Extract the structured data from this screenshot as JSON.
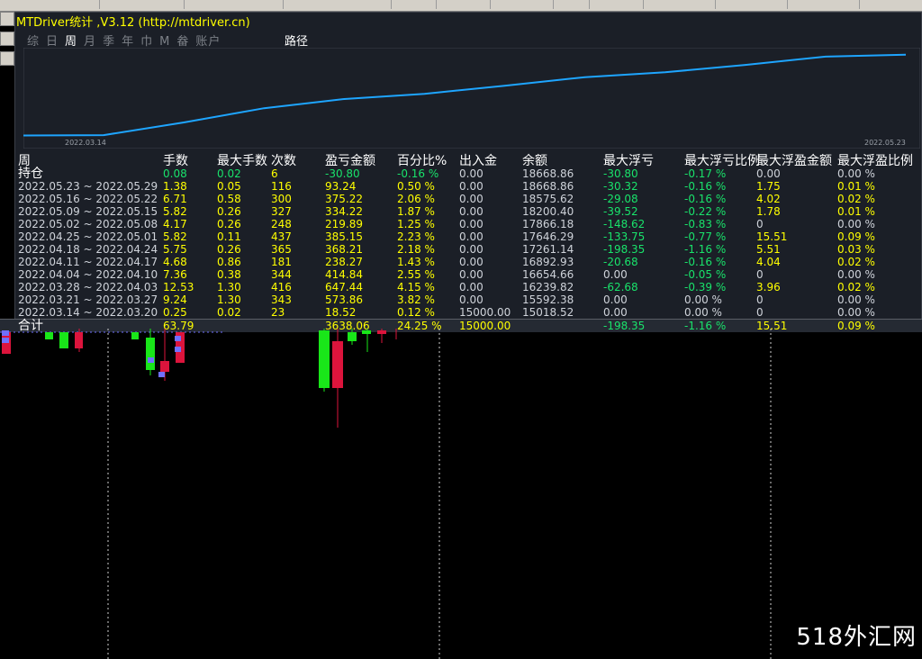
{
  "window": {
    "title": "MTDriver统计  ,V3.12 (http://mtdriver.cn)"
  },
  "tabs": {
    "items": [
      "综",
      "日",
      "周",
      "月",
      "季",
      "年",
      "巾",
      "M",
      "畚",
      "账户"
    ],
    "selected": "周",
    "path": "路径"
  },
  "equity_chart": {
    "x_start": "2022.03.14",
    "x_end": "2022.05.23",
    "line_color": "#1ea5ff",
    "chart_data": {
      "type": "line",
      "x": [
        "2022.03.14",
        "2022.03.21",
        "2022.03.28",
        "2022.04.04",
        "2022.04.11",
        "2022.04.18",
        "2022.04.25",
        "2022.05.02",
        "2022.05.09",
        "2022.05.16",
        "2022.05.23"
      ],
      "values": [
        15000,
        15018.52,
        15592.38,
        16239.82,
        16654.66,
        16892.93,
        17261.14,
        17646.29,
        17866.18,
        18200.4,
        18575.62,
        18668.86
      ]
    }
  },
  "table": {
    "headers": [
      "周",
      "手数",
      "最大手数",
      "次数",
      "盈亏金额",
      "百分比%",
      "出入金",
      "余额",
      "最大浮亏",
      "最大浮亏比例",
      "最大浮盈金额",
      "最大浮盈比例"
    ],
    "holding": {
      "label": "持仓",
      "lots": "0.08",
      "max_lots": "0.02",
      "count": "6",
      "pnl": "-30.80",
      "pct": "-0.16 %",
      "flow": "0.00",
      "balance": "18668.86",
      "max_loss": "-30.80",
      "max_loss_pct": "-0.17 %",
      "max_gain": "0.00",
      "max_gain_pct": "0.00 %"
    },
    "rows": [
      {
        "period": "2022.05.23 ~ 2022.05.29",
        "lots": "1.38",
        "max_lots": "0.05",
        "count": "116",
        "pnl": "93.24",
        "pct": "0.50 %",
        "flow": "0.00",
        "balance": "18668.86",
        "max_loss": "-30.32",
        "max_loss_pct": "-0.16 %",
        "max_gain": "1.75",
        "max_gain_pct": "0.01 %"
      },
      {
        "period": "2022.05.16 ~ 2022.05.22",
        "lots": "6.71",
        "max_lots": "0.58",
        "count": "300",
        "pnl": "375.22",
        "pct": "2.06 %",
        "flow": "0.00",
        "balance": "18575.62",
        "max_loss": "-29.08",
        "max_loss_pct": "-0.16 %",
        "max_gain": "4.02",
        "max_gain_pct": "0.02 %"
      },
      {
        "period": "2022.05.09 ~ 2022.05.15",
        "lots": "5.82",
        "max_lots": "0.26",
        "count": "327",
        "pnl": "334.22",
        "pct": "1.87 %",
        "flow": "0.00",
        "balance": "18200.40",
        "max_loss": "-39.52",
        "max_loss_pct": "-0.22 %",
        "max_gain": "1.78",
        "max_gain_pct": "0.01 %"
      },
      {
        "period": "2022.05.02 ~ 2022.05.08",
        "lots": "4.17",
        "max_lots": "0.26",
        "count": "248",
        "pnl": "219.89",
        "pct": "1.25 %",
        "flow": "0.00",
        "balance": "17866.18",
        "max_loss": "-148.62",
        "max_loss_pct": "-0.83 %",
        "max_gain": "0",
        "max_gain_pct": "0.00 %"
      },
      {
        "period": "2022.04.25 ~ 2022.05.01",
        "lots": "5.82",
        "max_lots": "0.11",
        "count": "437",
        "pnl": "385.15",
        "pct": "2.23 %",
        "flow": "0.00",
        "balance": "17646.29",
        "max_loss": "-133.75",
        "max_loss_pct": "-0.77 %",
        "max_gain": "15.51",
        "max_gain_pct": "0.09 %"
      },
      {
        "period": "2022.04.18 ~ 2022.04.24",
        "lots": "5.75",
        "max_lots": "0.26",
        "count": "365",
        "pnl": "368.21",
        "pct": "2.18 %",
        "flow": "0.00",
        "balance": "17261.14",
        "max_loss": "-198.35",
        "max_loss_pct": "-1.16 %",
        "max_gain": "5.51",
        "max_gain_pct": "0.03 %"
      },
      {
        "period": "2022.04.11 ~ 2022.04.17",
        "lots": "4.68",
        "max_lots": "0.86",
        "count": "181",
        "pnl": "238.27",
        "pct": "1.43 %",
        "flow": "0.00",
        "balance": "16892.93",
        "max_loss": "-20.68",
        "max_loss_pct": "-0.16 %",
        "max_gain": "4.04",
        "max_gain_pct": "0.02 %"
      },
      {
        "period": "2022.04.04 ~ 2022.04.10",
        "lots": "7.36",
        "max_lots": "0.38",
        "count": "344",
        "pnl": "414.84",
        "pct": "2.55 %",
        "flow": "0.00",
        "balance": "16654.66",
        "max_loss": "0.00",
        "max_loss_pct": "-0.05 %",
        "max_gain": "0",
        "max_gain_pct": "0.00 %"
      },
      {
        "period": "2022.03.28 ~ 2022.04.03",
        "lots": "12.53",
        "max_lots": "1.30",
        "count": "416",
        "pnl": "647.44",
        "pct": "4.15 %",
        "flow": "0.00",
        "balance": "16239.82",
        "max_loss": "-62.68",
        "max_loss_pct": "-0.39 %",
        "max_gain": "3.96",
        "max_gain_pct": "0.02 %"
      },
      {
        "period": "2022.03.21 ~ 2022.03.27",
        "lots": "9.24",
        "max_lots": "1.30",
        "count": "343",
        "pnl": "573.86",
        "pct": "3.82 %",
        "flow": "0.00",
        "balance": "15592.38",
        "max_loss": "0.00",
        "max_loss_pct": "0.00 %",
        "max_gain": "0",
        "max_gain_pct": "0.00 %"
      },
      {
        "period": "2022.03.14 ~ 2022.03.20",
        "lots": "0.25",
        "max_lots": "0.02",
        "count": "23",
        "pnl": "18.52",
        "pct": "0.12 %",
        "flow": "15000.00",
        "balance": "15018.52",
        "max_loss": "0.00",
        "max_loss_pct": "0.00 %",
        "max_gain": "0",
        "max_gain_pct": "0.00 %"
      }
    ],
    "total": {
      "label": "合计",
      "lots": "63.79",
      "pnl": "3638.06",
      "pct": "24.25 %",
      "flow": "15000.00",
      "max_loss": "-198.35",
      "max_loss_pct": "-1.16 %",
      "max_gain": "15.51",
      "max_gain_pct": "0.09 %"
    }
  },
  "watermark": "518外汇网",
  "colors": {
    "bull": "#19e619",
    "bear": "#dc143c",
    "positive": "#ffff00",
    "negative": "#19e36b"
  }
}
